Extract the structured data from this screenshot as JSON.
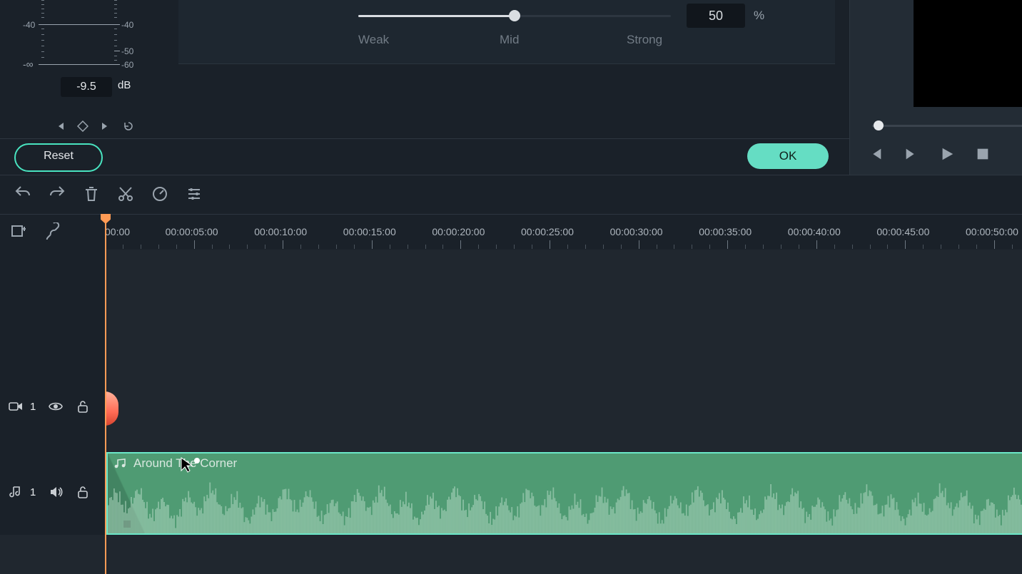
{
  "meter": {
    "value_box": "-9.5",
    "unit": "dB",
    "left_ticks": [
      "-40",
      "-∞"
    ],
    "right_ticks": [
      "-40",
      "-50",
      "-60"
    ]
  },
  "strength": {
    "weak": "Weak",
    "mid": "Mid",
    "strong": "Strong",
    "value": "50",
    "unit": "%"
  },
  "buttons": {
    "reset": "Reset",
    "ok": "OK"
  },
  "timeline": {
    "labels": [
      "00:00",
      "00:00:05:00",
      "00:00:10:00",
      "00:00:15:00",
      "00:00:20:00",
      "00:00:25:00",
      "00:00:30:00",
      "00:00:35:00",
      "00:00:40:00",
      "00:00:45:00",
      "00:00:50:00"
    ]
  },
  "tracks": {
    "video_number": "1",
    "audio_number": "1"
  },
  "clip": {
    "title": "Around The Corner"
  }
}
